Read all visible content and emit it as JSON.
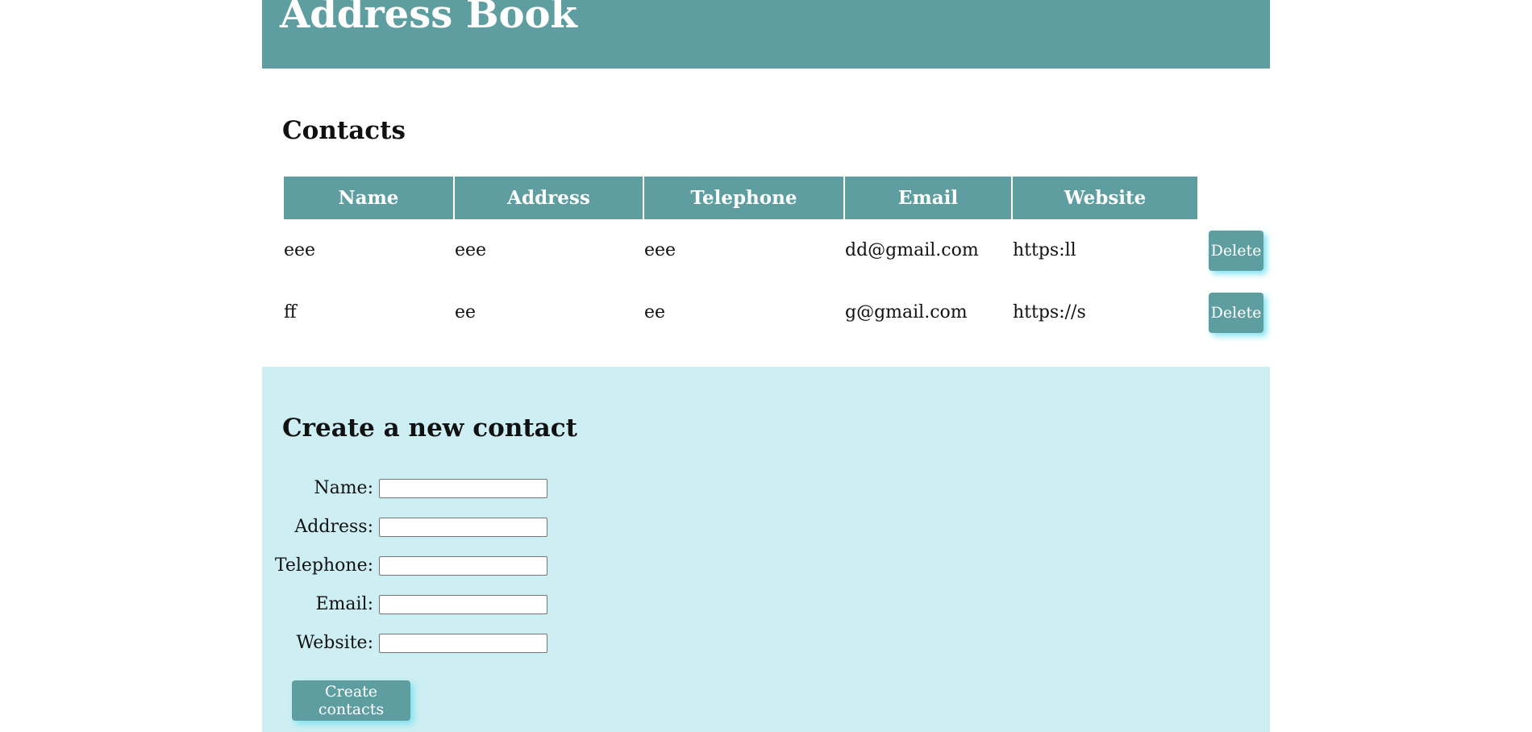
{
  "header": {
    "title": "Address Book"
  },
  "contacts": {
    "heading": "Contacts",
    "columns": [
      "Name",
      "Address",
      "Telephone",
      "Email",
      "Website"
    ],
    "rows": [
      {
        "name": "eee",
        "address": "eee",
        "telephone": "eee",
        "email": "dd@gmail.com",
        "website": "https:ll",
        "action": "Delete"
      },
      {
        "name": "ff",
        "address": "ee",
        "telephone": "ee",
        "email": "g@gmail.com",
        "website": "https://s",
        "action": "Delete"
      }
    ]
  },
  "create_form": {
    "heading": "Create a new contact",
    "fields": [
      {
        "label": "Name:",
        "value": ""
      },
      {
        "label": "Address:",
        "value": ""
      },
      {
        "label": "Telephone:",
        "value": ""
      },
      {
        "label": "Email:",
        "value": ""
      },
      {
        "label": "Website:",
        "value": ""
      }
    ],
    "submit_label": "Create contacts"
  },
  "colors": {
    "accent": "#5f9ea0",
    "panel_background": "#cdeef3",
    "button_glow": "#7fe3f0"
  }
}
